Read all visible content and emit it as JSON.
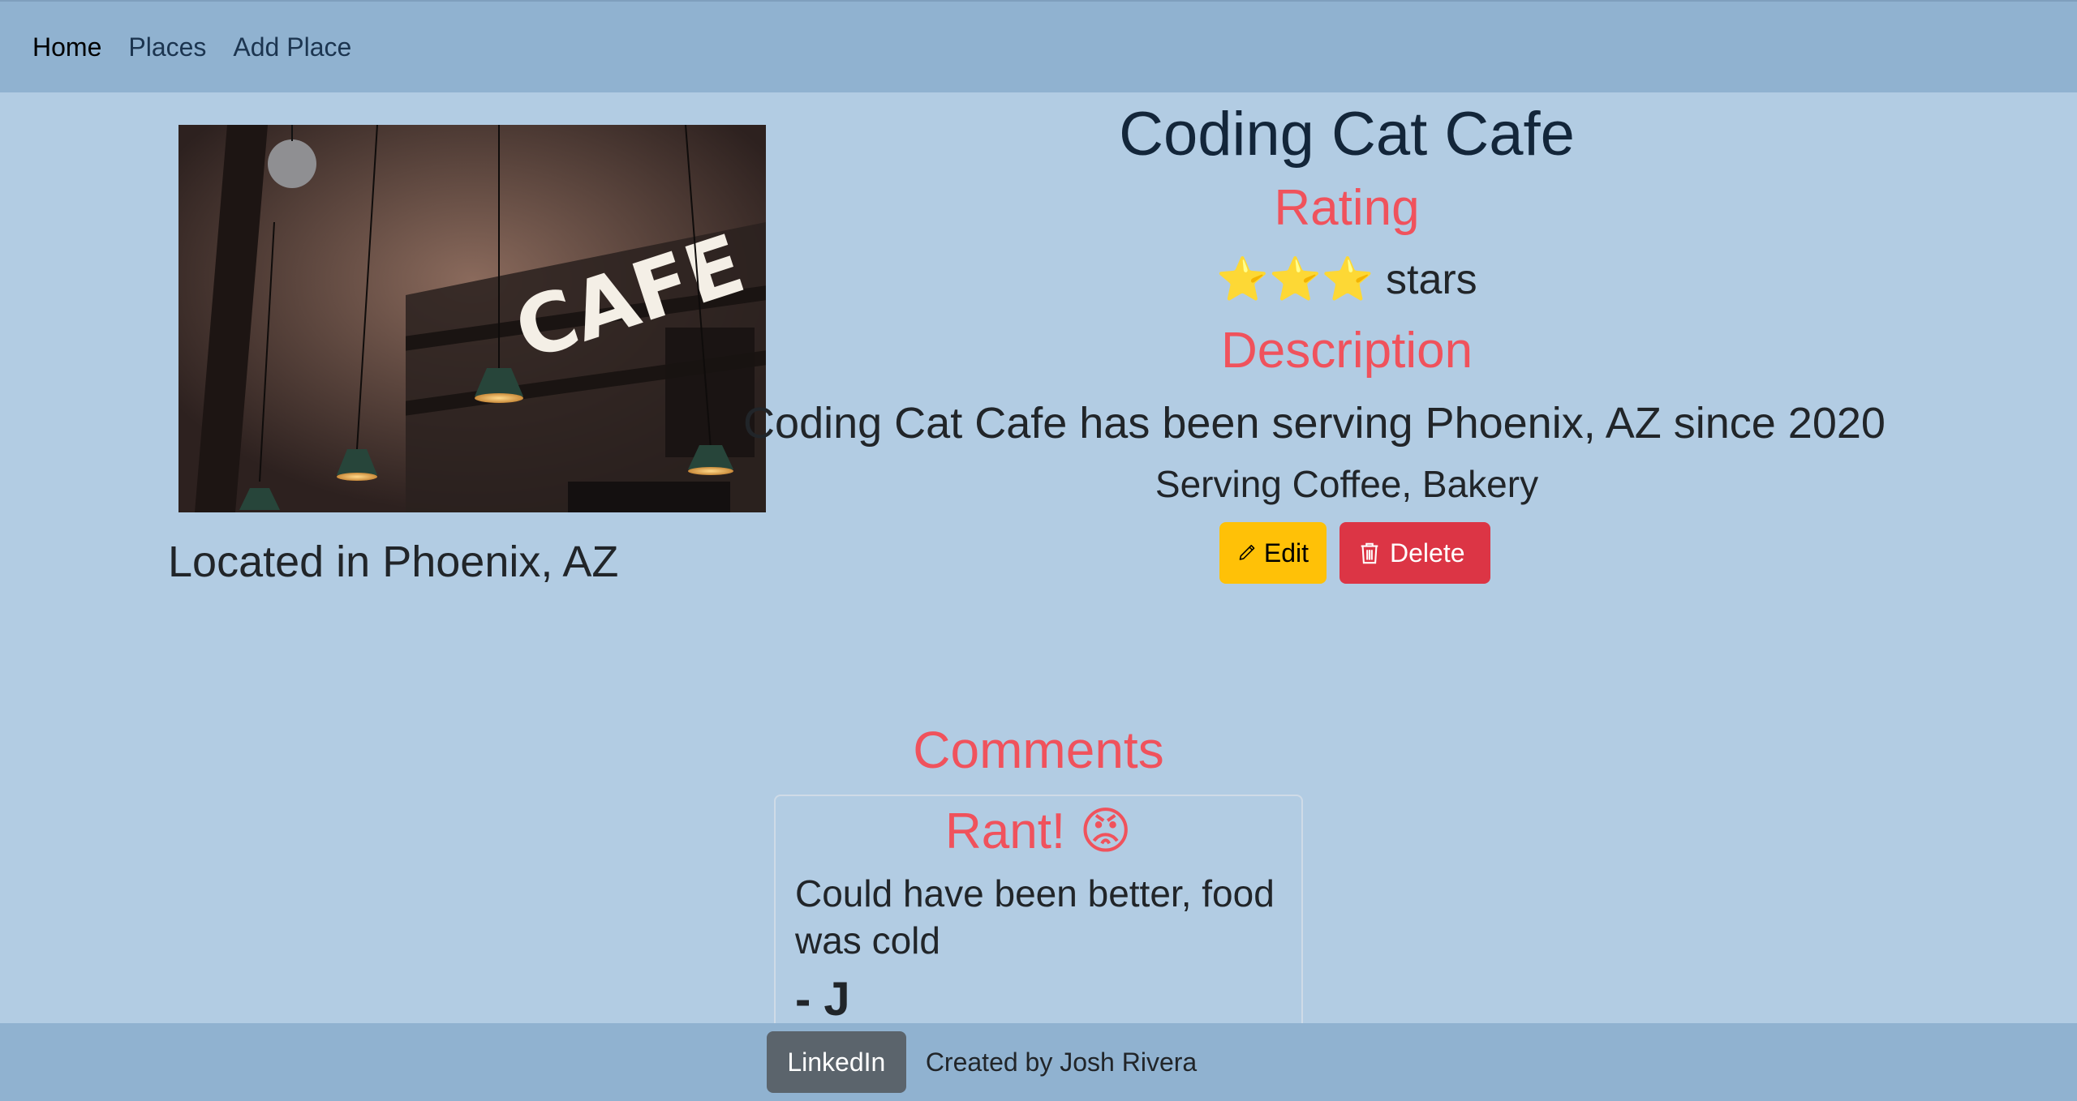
{
  "nav": {
    "items": [
      {
        "label": "Home"
      },
      {
        "label": "Places"
      },
      {
        "label": "Add Place"
      }
    ]
  },
  "place": {
    "image_text": "CAFE",
    "location": "Located in Phoenix, AZ",
    "name": "Coding Cat Cafe",
    "rating_heading": "Rating",
    "stars_icons": "⭐⭐⭐",
    "stars_label": "stars",
    "rating_value": 3,
    "description_heading": "Description",
    "description": "Coding Cat Cafe has been serving Phoenix, AZ since 2020",
    "serving": "Serving Coffee, Bakery"
  },
  "actions": {
    "edit_label": "Edit",
    "delete_label": "Delete",
    "edit_icon": "pencil-icon",
    "delete_icon": "trash-icon"
  },
  "comments": {
    "heading": "Comments",
    "items": [
      {
        "type": "Rant! 😡",
        "content": "Could have been better, food was cold",
        "author": "- J"
      }
    ]
  },
  "footer": {
    "linkedin_label": "LinkedIn",
    "credit": "Created by Josh Rivera"
  },
  "colors": {
    "background": "#b2cce3",
    "nav": "#90b2d0",
    "accent": "#f0525c",
    "edit": "#ffc107",
    "delete": "#dc3545"
  }
}
